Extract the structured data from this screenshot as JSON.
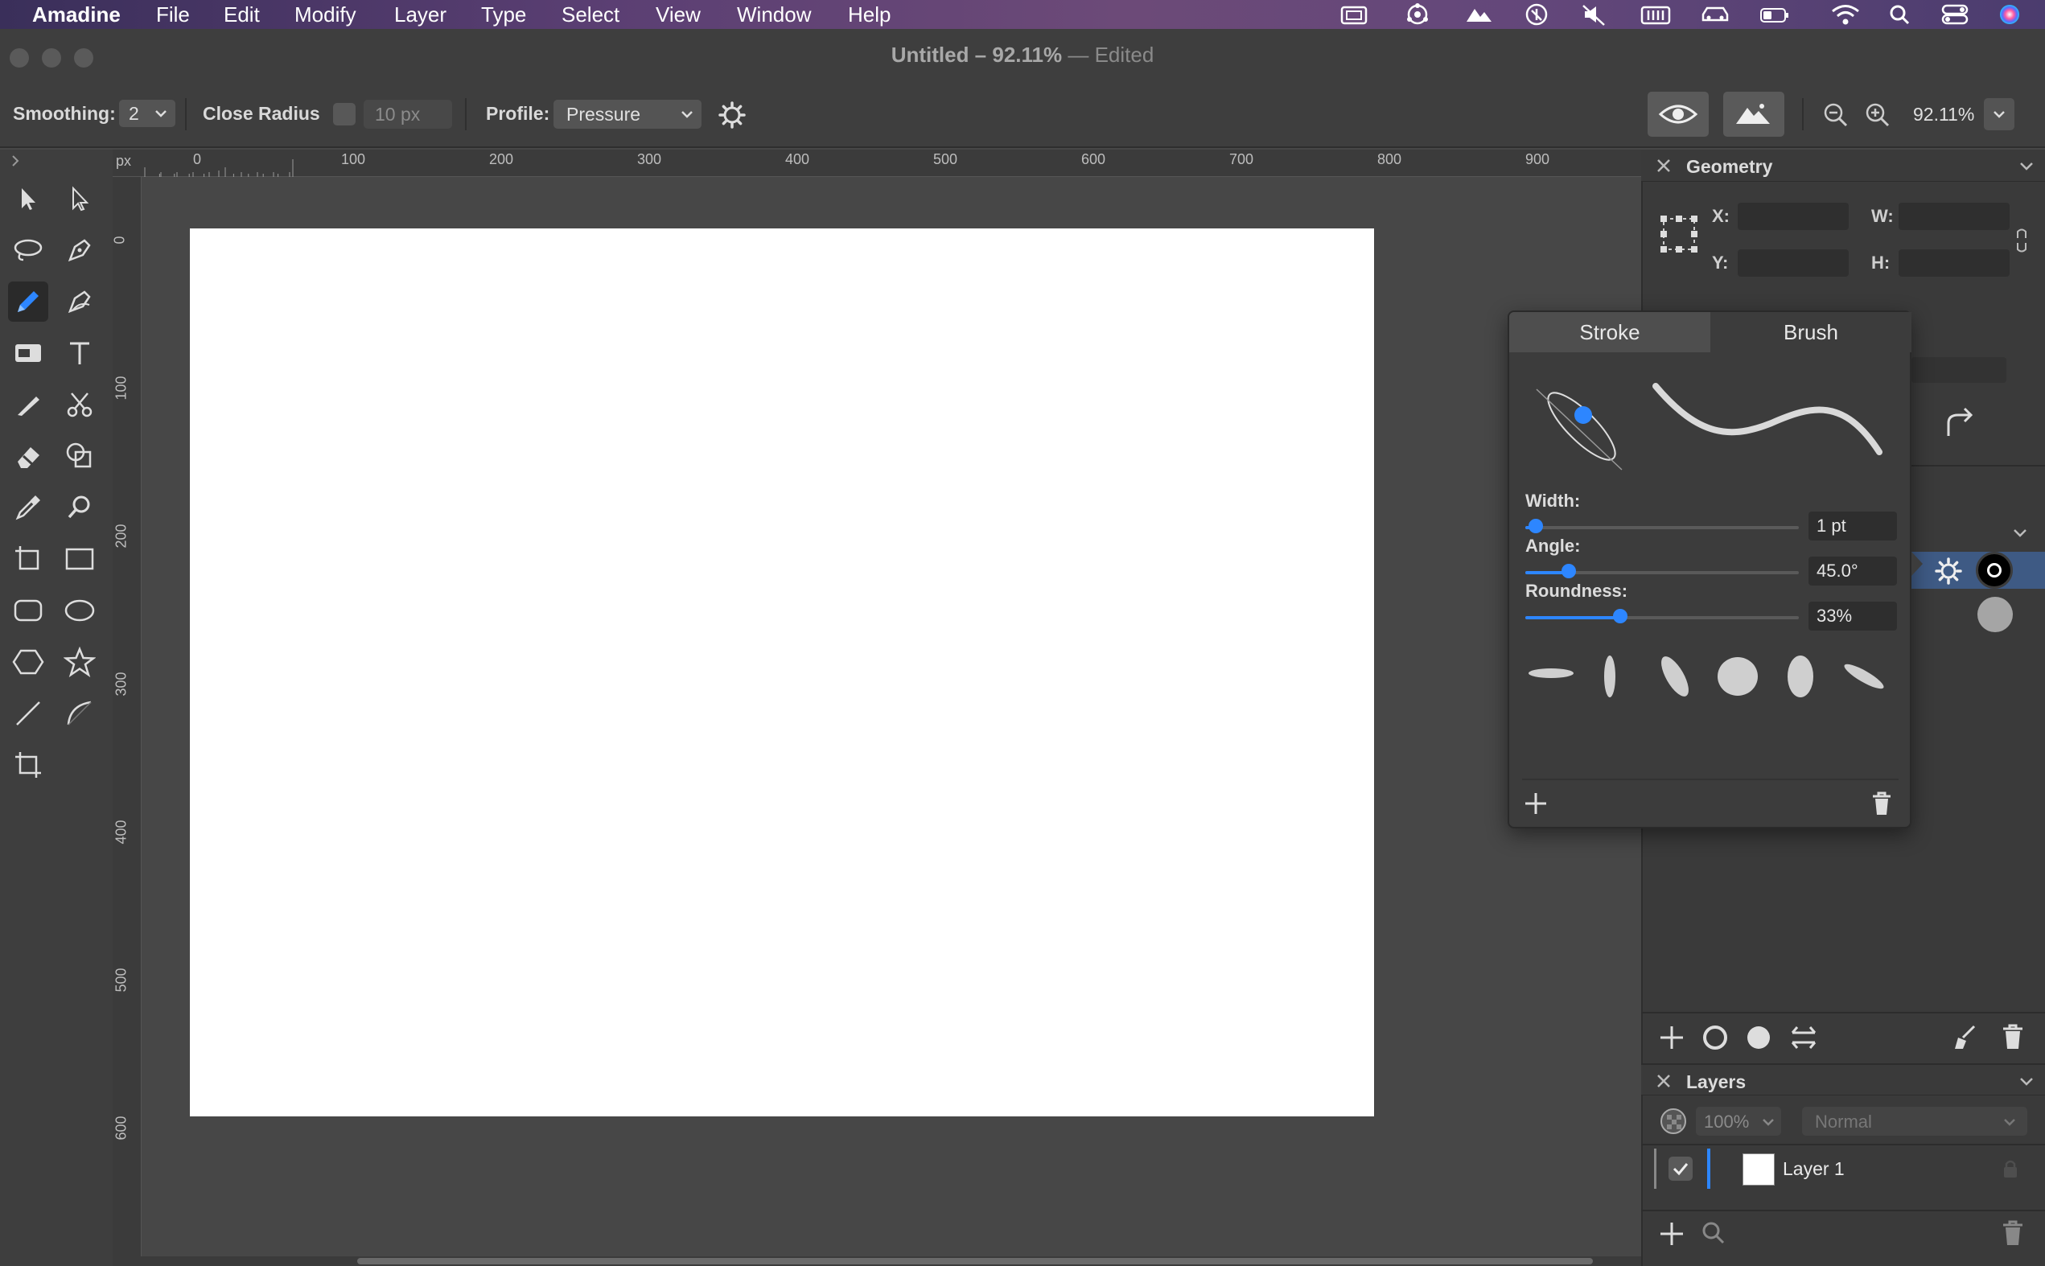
{
  "menubar": {
    "app": "Amadine",
    "items": [
      "File",
      "Edit",
      "Modify",
      "Layer",
      "Type",
      "Select",
      "View",
      "Window",
      "Help"
    ]
  },
  "window": {
    "title": "Untitled – 92.11%",
    "separator": " — ",
    "status": "Edited"
  },
  "toolbar": {
    "smoothing_label": "Smoothing:",
    "smoothing_value": "2",
    "close_radius_label": "Close Radius",
    "close_radius_value": "10 px",
    "profile_label": "Profile:",
    "profile_value": "Pressure",
    "zoom_value": "92.11%"
  },
  "ruler": {
    "unit": "px",
    "h_ticks": [
      "0",
      "100",
      "200",
      "300",
      "400",
      "500",
      "600",
      "700",
      "800",
      "900"
    ],
    "v_ticks": [
      "0",
      "100",
      "200",
      "300",
      "400",
      "500",
      "600"
    ]
  },
  "geometry_panel": {
    "title": "Geometry",
    "x_label": "X:",
    "y_label": "Y:",
    "w_label": "W:",
    "h_label": "H:"
  },
  "brush_popover": {
    "tabs": [
      "Stroke",
      "Brush"
    ],
    "active_tab": "Brush",
    "width_label": "Width:",
    "width_value": "1 pt",
    "width_fraction": 0.02,
    "angle_label": "Angle:",
    "angle_value": "45.0°",
    "angle_fraction": 0.14,
    "roundness_label": "Roundness:",
    "roundness_value": "33%",
    "roundness_fraction": 0.33
  },
  "layers_panel": {
    "title": "Layers",
    "opacity": "100%",
    "blend_mode": "Normal",
    "layers": [
      {
        "name": "Layer 1",
        "visible": true
      }
    ]
  },
  "colors": {
    "accent": "#2d86ff",
    "panel": "#3a3a3a",
    "canvas": "#474747"
  }
}
